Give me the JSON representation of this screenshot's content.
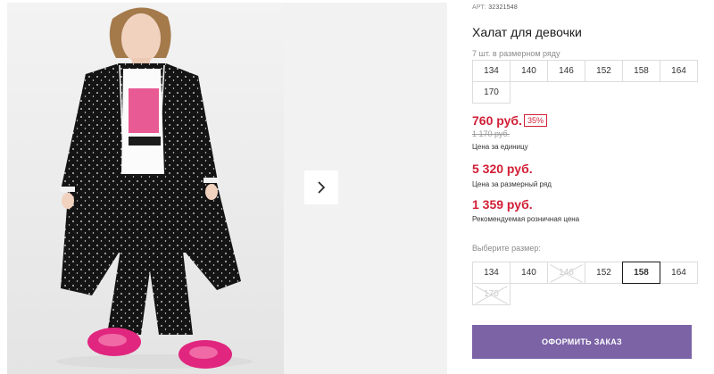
{
  "product": {
    "article_label": "АРТ:",
    "article_value": "32321548",
    "title": "Халат для девочки",
    "image_alt": "Фото товара: халат для девочки"
  },
  "pack": {
    "caption": "7 шт. в размерном ряду",
    "sizes": [
      "134",
      "140",
      "146",
      "152",
      "158",
      "164",
      "170"
    ]
  },
  "prices": {
    "current": "760 руб.",
    "discount": "35%",
    "old": "1 170 руб.",
    "unit_caption": "Цена за единицу",
    "pack_price": "5 320 руб.",
    "pack_caption": "Цена за размерный ряд",
    "retail_price": "1 359 руб.",
    "retail_caption": "Рекомендуемая розничная цена"
  },
  "size_picker": {
    "label": "Выберите размер:",
    "sizes": [
      {
        "label": "134",
        "state": "available"
      },
      {
        "label": "140",
        "state": "available"
      },
      {
        "label": "146",
        "state": "unavailable"
      },
      {
        "label": "152",
        "state": "available"
      },
      {
        "label": "158",
        "state": "selected"
      },
      {
        "label": "164",
        "state": "available"
      },
      {
        "label": "170",
        "state": "unavailable"
      }
    ]
  },
  "actions": {
    "order_label": "ОФОРМИТЬ ЗАКАЗ",
    "next_icon": "chevron-right-icon"
  },
  "colors": {
    "accent_price": "#d11f36",
    "order_button": "#7b63a6",
    "photo_background": "#ededed"
  }
}
